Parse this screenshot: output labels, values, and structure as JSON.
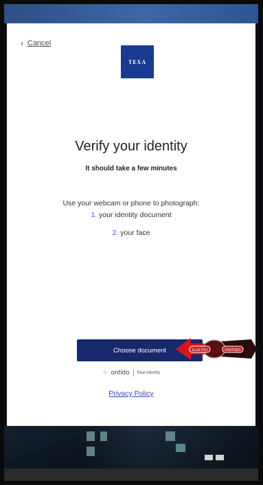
{
  "nav": {
    "back_label": "Cancel"
  },
  "brand": {
    "logo_text": "TEXA",
    "logo_color": "#1a3a8f"
  },
  "content": {
    "title": "Verify your identity",
    "subtitle": "It should take a few minutes",
    "instruction": "Use your webcam or phone to photograph:",
    "steps": [
      {
        "num": "1.",
        "label": "your identity document"
      },
      {
        "num": "2.",
        "label": "your face"
      }
    ]
  },
  "actions": {
    "primary_label": "Choose document",
    "primary_color": "#17296b"
  },
  "footer": {
    "provider": "onfido",
    "provider_tagline": "Real Identity",
    "privacy_label": "Privacy Policy"
  },
  "overlay_badge": {
    "left_text": "ELEKTRO",
    "right_text": "PARTNER"
  }
}
